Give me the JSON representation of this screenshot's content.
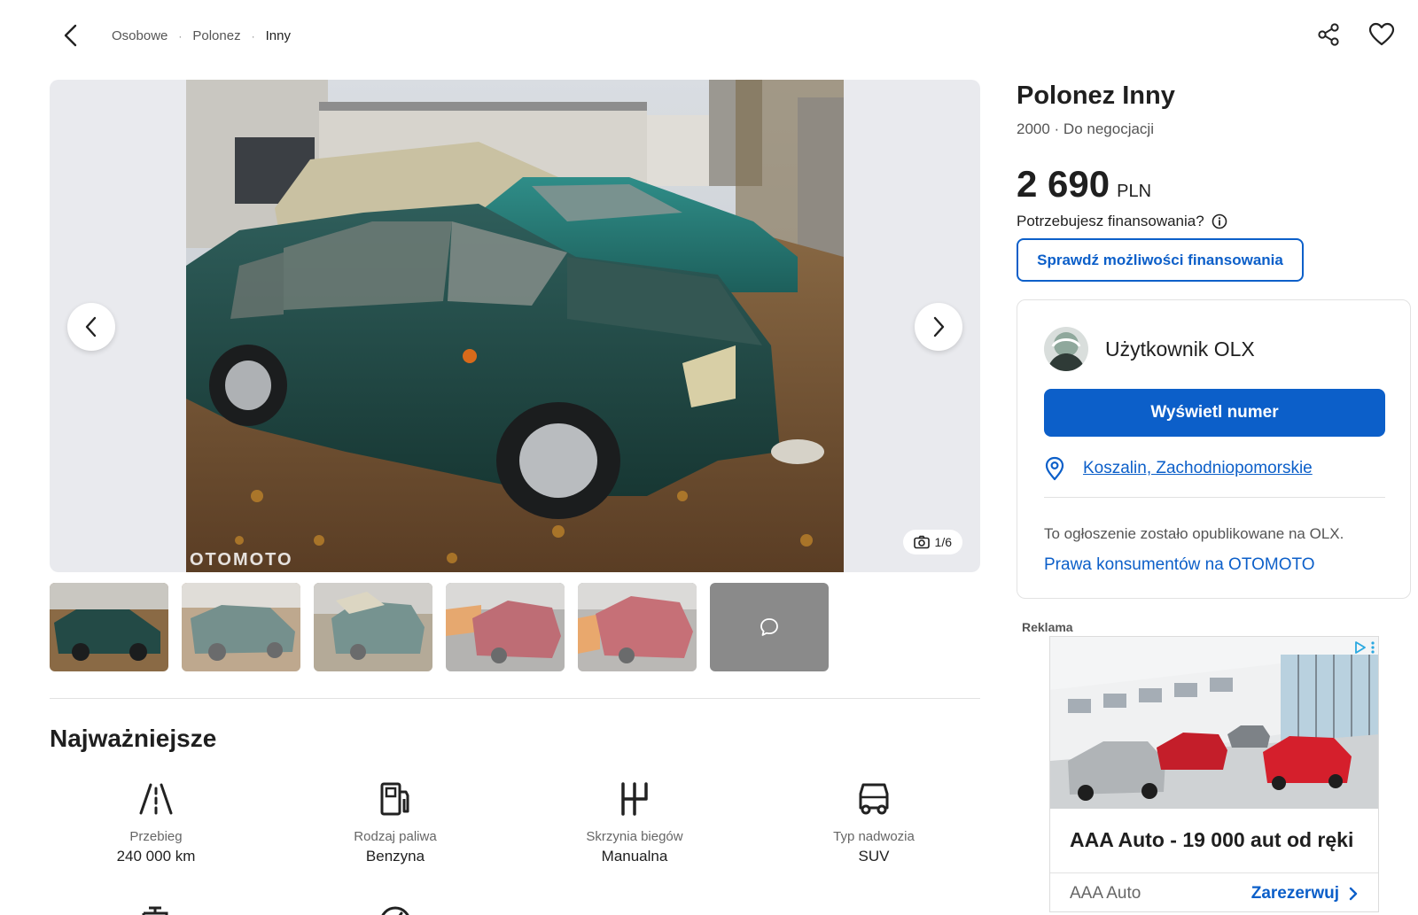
{
  "header": {
    "back_icon": "chevron-left-icon",
    "breadcrumb": [
      "Osobowe",
      "Polonez",
      "Inny"
    ],
    "share_icon": "share-icon",
    "favorite_icon": "heart-icon"
  },
  "gallery": {
    "watermark": "OTOMOTO",
    "counter": "1/6",
    "prev_icon": "chevron-left-icon",
    "next_icon": "chevron-right-icon",
    "thumbnails": [
      "photo-1",
      "photo-2",
      "photo-3",
      "photo-4",
      "photo-5",
      "message-more"
    ]
  },
  "highlights": {
    "title": "Najważniejsze",
    "items": [
      {
        "label": "Przebieg",
        "value": "240 000 km",
        "icon": "road-icon"
      },
      {
        "label": "Rodzaj paliwa",
        "value": "Benzyna",
        "icon": "fuel-pump-icon"
      },
      {
        "label": "Skrzynia biegów",
        "value": "Manualna",
        "icon": "gearbox-icon"
      },
      {
        "label": "Typ nadwozia",
        "value": "SUV",
        "icon": "car-body-icon"
      }
    ]
  },
  "listing": {
    "title": "Polonez Inny",
    "subtitle": "2000 · Do negocjacji",
    "price": "2 690",
    "currency": "PLN",
    "finance_question": "Potrzebujesz finansowania?",
    "finance_button": "Sprawdź możliwości finansowania"
  },
  "seller": {
    "name": "Użytkownik OLX",
    "show_number": "Wyświetl numer",
    "location": "Koszalin, Zachodniopomorskie",
    "olx_note": "To ogłoszenie zostało opublikowane na OLX.",
    "consumer_rights": "Prawa konsumentów na OTOMOTO"
  },
  "ad": {
    "label": "Reklama",
    "headline": "AAA Auto - 19 000 aut od ręki",
    "brand": "AAA Auto",
    "cta": "Zarezerwuj"
  },
  "colors": {
    "accent": "#0c5fc9",
    "car_green": "#1f4d4a",
    "text": "#1f1f1f"
  }
}
